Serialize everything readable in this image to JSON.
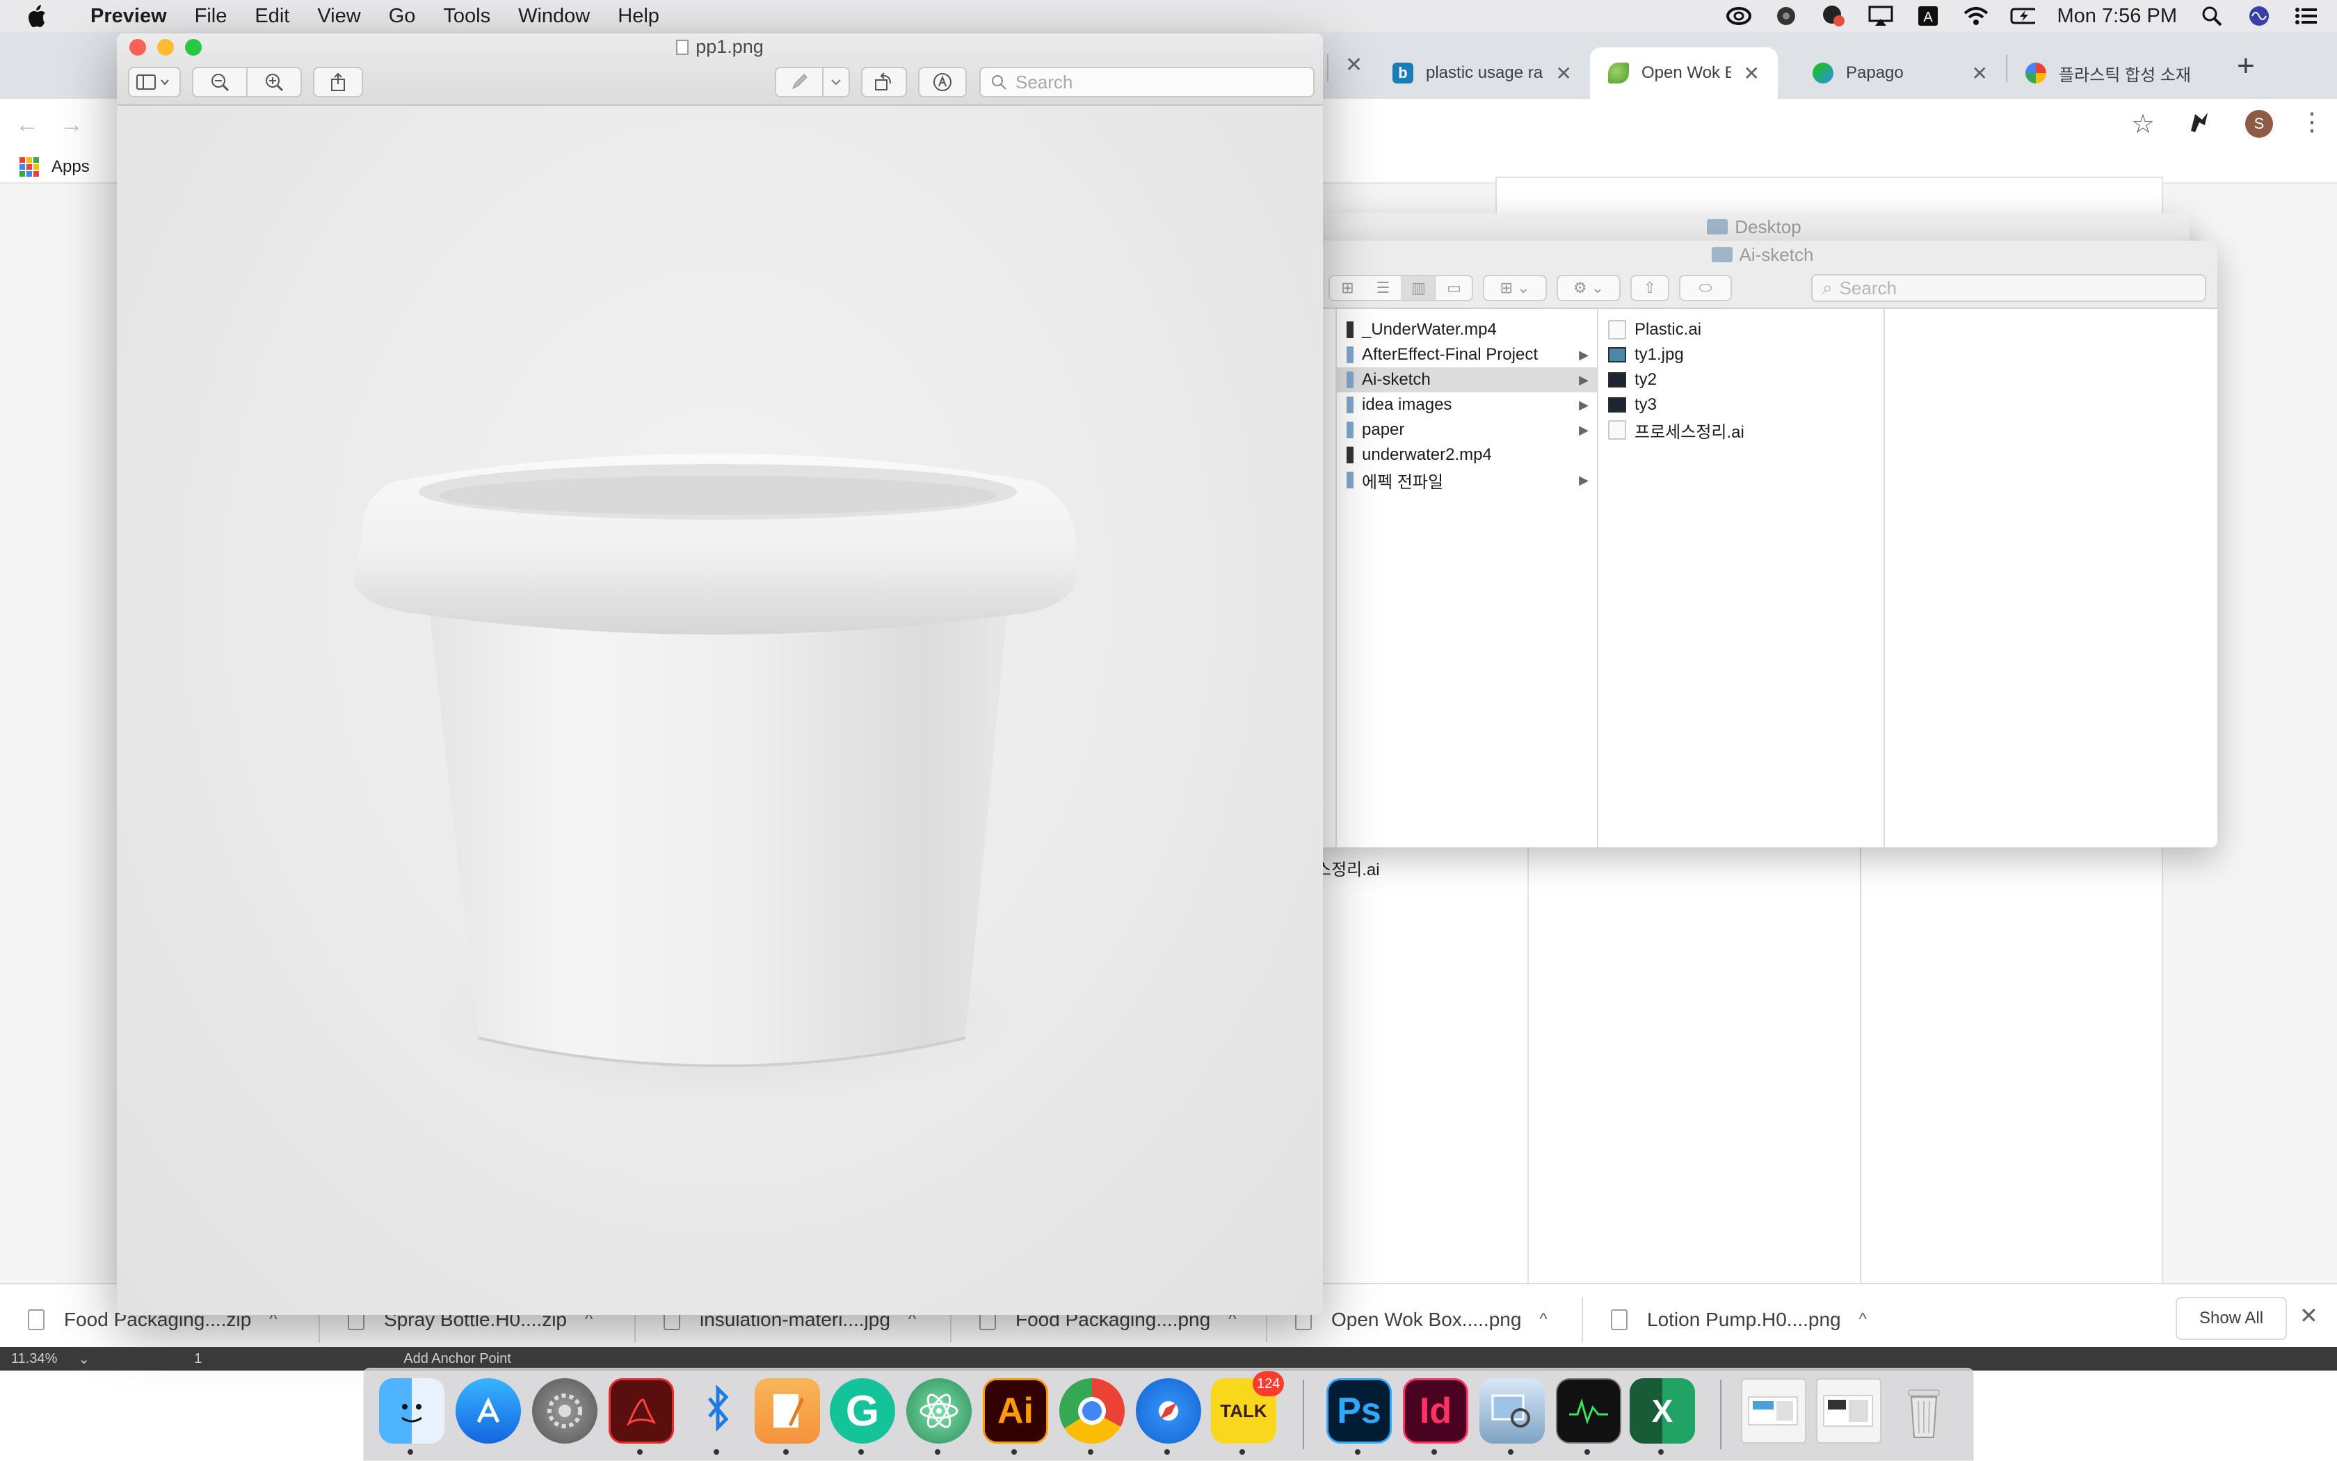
{
  "menubar": {
    "app_name": "Preview",
    "menus": [
      "File",
      "Edit",
      "View",
      "Go",
      "Tools",
      "Window",
      "Help"
    ],
    "clock": "Mon 7:56 PM"
  },
  "chrome": {
    "tabs": [
      {
        "title": "plastic usage ra",
        "icon": "bing-favicon",
        "active": false
      },
      {
        "title": "Open Wok Box l",
        "icon": "leaf-favicon",
        "active": true
      },
      {
        "title": "Papago",
        "icon": "papago-favicon",
        "active": false
      },
      {
        "title": "플라스틱 합성 소재",
        "icon": "google-favicon",
        "active": false
      }
    ],
    "new_tab": "+",
    "bookmarks_apps": "Apps",
    "profile_initial": "S",
    "downloads": [
      "Food Packaging....zip",
      "Spray Bottle.H0....zip",
      "insulation-materi....jpg",
      "Food Packaging....png",
      "Open Wok Box.....png",
      "Lotion Pump.H0....png"
    ],
    "show_all": "Show All",
    "behind_text": "스정리.ai"
  },
  "finder_desktop": {
    "title": "Desktop"
  },
  "finder_ai": {
    "title": "Ai-sketch",
    "search_placeholder": "Search",
    "col1": [
      {
        "name": "_UnderWater.mp4",
        "kind": "video",
        "folder": false
      },
      {
        "name": "AfterEffect-Final Project",
        "kind": "folder",
        "folder": true
      },
      {
        "name": "Ai-sketch",
        "kind": "folder",
        "folder": true,
        "selected": true
      },
      {
        "name": "idea images",
        "kind": "folder",
        "folder": true
      },
      {
        "name": "paper",
        "kind": "folder",
        "folder": true
      },
      {
        "name": "underwater2.mp4",
        "kind": "video",
        "folder": false
      },
      {
        "name": "에펙 전파일",
        "kind": "folder",
        "folder": true
      }
    ],
    "col2": [
      {
        "name": "Plastic.ai",
        "kind": "doc"
      },
      {
        "name": "ty1.jpg",
        "kind": "img"
      },
      {
        "name": "ty2",
        "kind": "img-dark"
      },
      {
        "name": "ty3",
        "kind": "img-dark"
      },
      {
        "name": "프로세스정리.ai",
        "kind": "doc"
      }
    ]
  },
  "preview": {
    "filename": "pp1.png",
    "search_placeholder": "Search",
    "image_subject": "white plastic cup"
  },
  "status_strip": {
    "zoom": "11.34%",
    "page": "1",
    "tool_hint": "Add Anchor Point"
  },
  "dock": {
    "apps": [
      "Finder",
      "App Store",
      "System Preferences",
      "Acrobat",
      "Bluetooth",
      "Pages",
      "Grammarly",
      "Atom",
      "Illustrator",
      "Chrome",
      "Safari",
      "KakaoTalk",
      "Photoshop",
      "InDesign",
      "Preview",
      "Activity Monitor",
      "Excel",
      "Stack 1",
      "Stack 2",
      "Trash"
    ],
    "kakao_badge": "124",
    "labels": {
      "illustrator": "Ai",
      "photoshop": "Ps",
      "indesign": "Id",
      "kakao": "TALK",
      "grammarly": "G",
      "excel": "X"
    }
  },
  "colors": {
    "menubar_bg": "#e9e9eb",
    "chrome_tabbar": "#dee1e6",
    "traffic_red": "#fe5f57",
    "traffic_yellow": "#febc2e",
    "traffic_green": "#28c840",
    "finder_selection": "#dcdcdc"
  }
}
